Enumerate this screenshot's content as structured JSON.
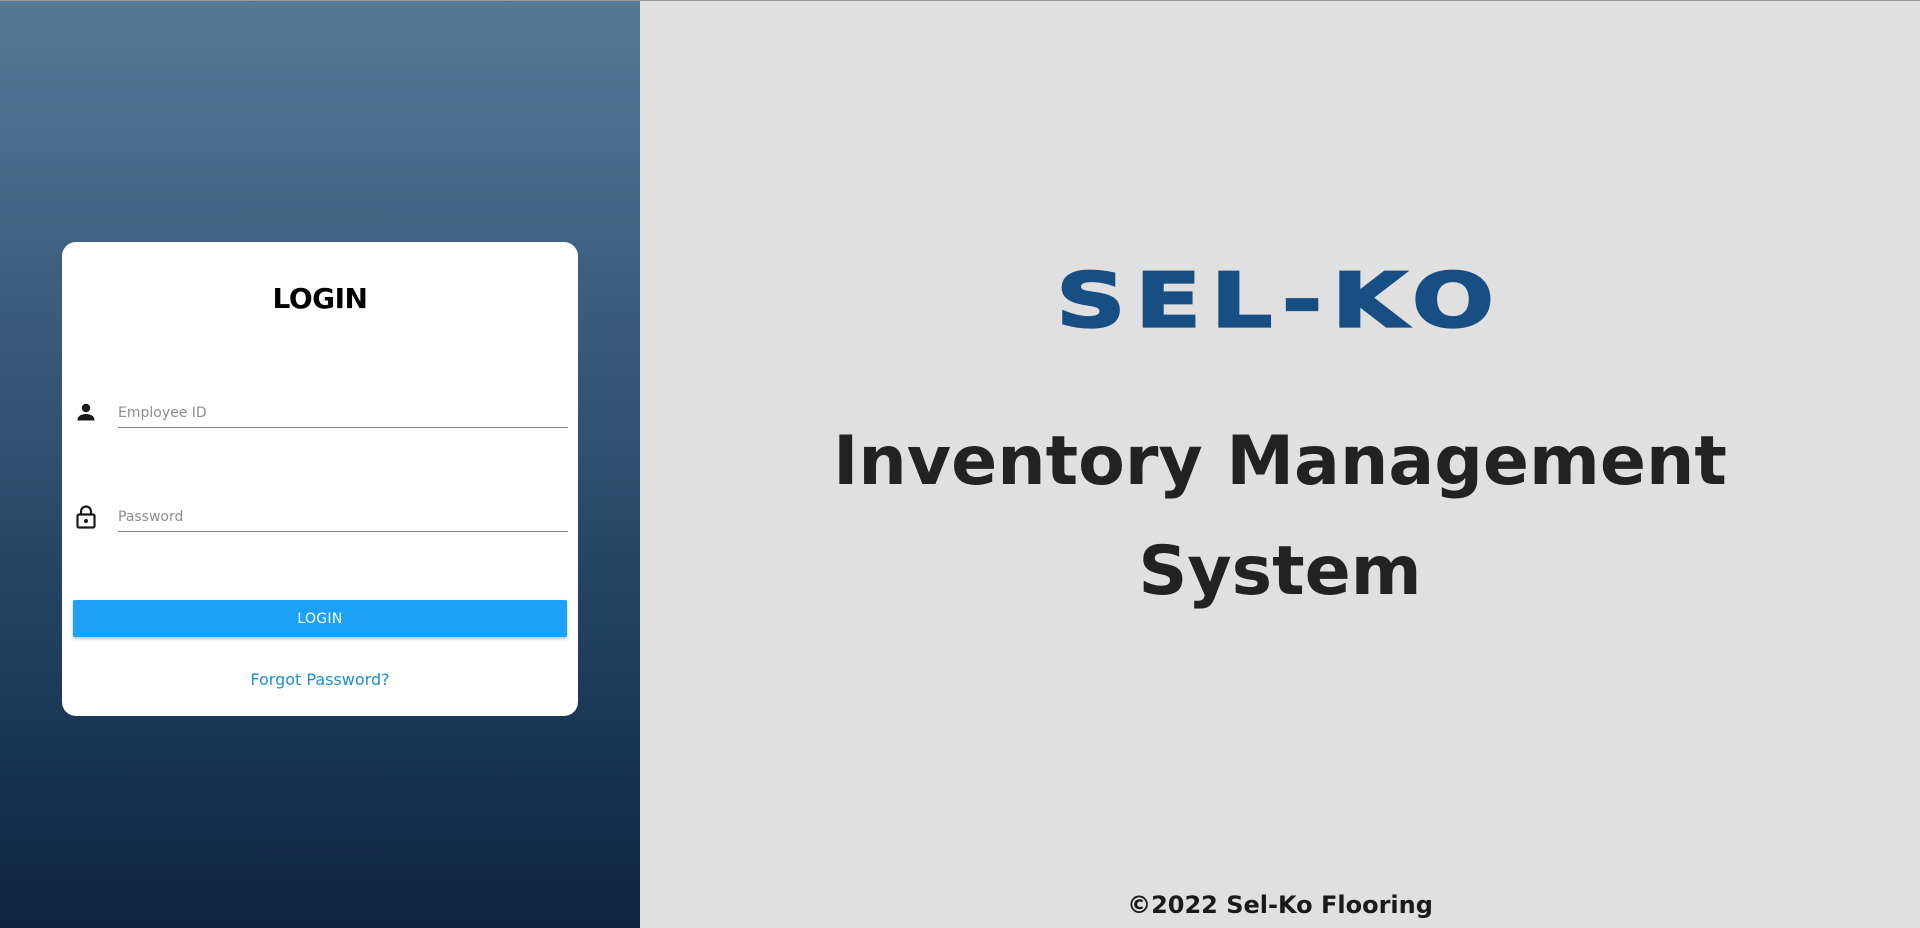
{
  "login_card": {
    "title": "LOGIN",
    "employee_id": {
      "placeholder": "Employee ID",
      "value": "",
      "icon": "person-icon"
    },
    "password": {
      "placeholder": "Password",
      "value": "",
      "icon": "lock-icon"
    },
    "login_button_label": "LOGIN",
    "forgot_password_label": "Forgot Password?"
  },
  "branding": {
    "logo_text": "SEL-KO",
    "system_title_line1": "Inventory Management",
    "system_title_line2": "System",
    "footer": "©2022 Sel-Ko Flooring"
  },
  "colors": {
    "accent": "#1ba2f6",
    "link": "#1b8fd6",
    "brand": "#174e83",
    "panel_gradient_top": "#547a98",
    "panel_gradient_bottom": "#0e2342",
    "right_background": "#e0e0e0"
  }
}
